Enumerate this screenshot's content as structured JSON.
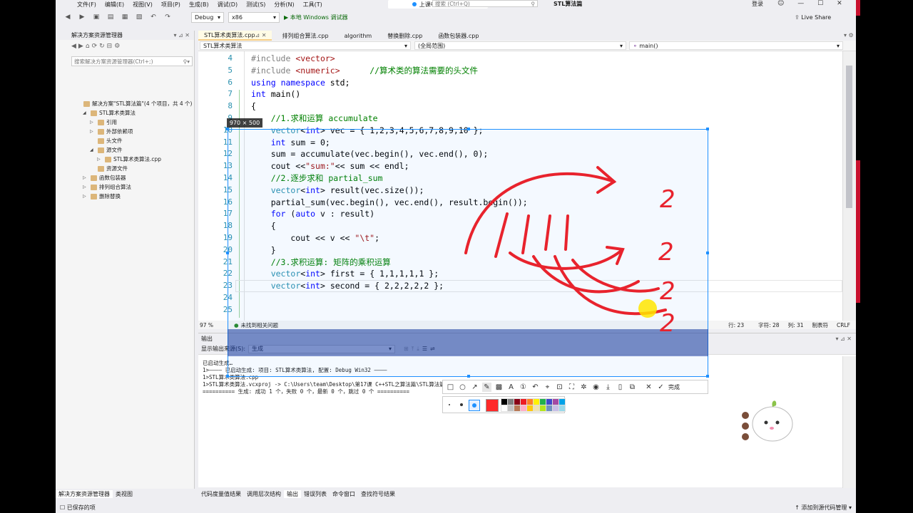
{
  "menu": [
    "文件(F)",
    "编辑(E)",
    "视图(V)",
    "项目(P)",
    "生成(B)",
    "调试(D)",
    "测试(S)",
    "分析(N)",
    "工具(T)"
  ],
  "live": {
    "recording": "上课中 02:10:56",
    "search_placeholder": "搜索 (Ctrl+Q)",
    "app_title": "STL算法篇",
    "login": "登录",
    "liveshare": "Live Share"
  },
  "toolbar": {
    "config": "Debug",
    "platform": "x86",
    "run": "▶ 本地 Windows 调试器"
  },
  "solution": {
    "title": "解决方案资源管理器",
    "search_placeholder": "搜索解决方案资源管理器(Ctrl+;)",
    "items": [
      {
        "label": "解决方案\"STL算法篇\"(4 个项目，共 4 个)",
        "indent": 0,
        "tri": ""
      },
      {
        "label": "STL算术类算法",
        "indent": 1,
        "tri": "◢"
      },
      {
        "label": "引用",
        "indent": 2,
        "tri": "▷"
      },
      {
        "label": "外部依赖项",
        "indent": 2,
        "tri": "▷"
      },
      {
        "label": "头文件",
        "indent": 2,
        "tri": ""
      },
      {
        "label": "源文件",
        "indent": 2,
        "tri": "◢"
      },
      {
        "label": "STL算术类算法.cpp",
        "indent": 3,
        "tri": "▷"
      },
      {
        "label": "资源文件",
        "indent": 2,
        "tri": ""
      },
      {
        "label": "函数包装器",
        "indent": 1,
        "tri": "▷"
      },
      {
        "label": "排列组合算法",
        "indent": 1,
        "tri": "▷"
      },
      {
        "label": "删除替换",
        "indent": 1,
        "tri": "▷"
      }
    ],
    "bottom_tabs": [
      "解决方案资源管理器",
      "类视图"
    ]
  },
  "editor": {
    "tabs": [
      "STL算术类算法.cpp",
      "排列组合算法.cpp",
      "algorithm",
      "替换删除.cpp",
      "函数包装器.cpp"
    ],
    "nav": {
      "project": "STL算术类算法",
      "scope": "(全局范围)",
      "member": "main()"
    },
    "zoom": "97 %",
    "issues": "未找到相关问题",
    "line_no": "行: 23",
    "char_no": "字符: 28",
    "col_no": "列: 31",
    "tabs_mode": "制表符",
    "eol": "CRLF",
    "lines": [
      {
        "n": "4",
        "html": "<span class='pp'>#include</span> <span class='inc'>&lt;vector&gt;</span>"
      },
      {
        "n": "5",
        "html": "<span class='pp'>#include</span> <span class='inc'>&lt;numeric&gt;</span>      <span class='cm'>//算术类的算法需要的头文件</span>"
      },
      {
        "n": "6",
        "html": "<span class='kw'>using</span> <span class='kw'>namespace</span> std;"
      },
      {
        "n": "7",
        "html": "<span class='kw'>int</span> main()"
      },
      {
        "n": "8",
        "html": "{"
      },
      {
        "n": "9",
        "html": "    <span class='cm'>//1.求和运算 accumulate</span>"
      },
      {
        "n": "10",
        "html": "    <span class='ty'>vector</span>&lt;<span class='kw'>int</span>&gt; vec = { 1,2,3,4,5,6,7,8,9,10 };"
      },
      {
        "n": "11",
        "html": "    <span class='kw'>int</span> sum = 0;"
      },
      {
        "n": "12",
        "html": "    sum = accumulate(vec.begin(), vec.end(), 0);"
      },
      {
        "n": "13",
        "html": "    cout &lt;&lt;<span class='st'>\"sum:\"</span>&lt;&lt; sum &lt;&lt; endl;"
      },
      {
        "n": "14",
        "html": "    <span class='cm'>//2.逐步求和 partial_sum</span>"
      },
      {
        "n": "15",
        "html": "    <span class='ty'>vector</span>&lt;<span class='kw'>int</span>&gt; result(vec.size());"
      },
      {
        "n": "16",
        "html": "    partial_sum(vec.begin(), vec.end(), result.begin());"
      },
      {
        "n": "17",
        "html": "    <span class='kw'>for</span> (<span class='kw'>auto</span> v : result)"
      },
      {
        "n": "18",
        "html": "    {"
      },
      {
        "n": "19",
        "html": "        cout &lt;&lt; v &lt;&lt; <span class='st'>\"\\t\"</span>;"
      },
      {
        "n": "20",
        "html": "    }"
      },
      {
        "n": "21",
        "html": "    <span class='cm'>//3.求积运算: 矩阵的乘积运算</span>"
      },
      {
        "n": "22",
        "html": "    <span class='ty'>vector</span>&lt;<span class='kw'>int</span>&gt; first = { 1,1,1,1,1 };"
      },
      {
        "n": "23",
        "html": "    <span class='ty'>vector</span>&lt;<span class='kw'>int</span>&gt; second = { 2,2,2,2,2 };"
      },
      {
        "n": "24",
        "html": ""
      },
      {
        "n": "25",
        "html": ""
      }
    ]
  },
  "output": {
    "title": "输出",
    "source_label": "显示输出来源(S):",
    "source_value": "生成",
    "lines": [
      "已启动生成…",
      "1>———— 已启动生成: 项目: STL算术类算法, 配置: Debug Win32 ————",
      "1>STL算术类算法.cpp",
      "1>STL算术类算法.vcxproj -> C:\\Users\\team\\Desktop\\第17课 C++STL之算法篇\\STL算法篇",
      "========== 生成: 成功 1 个，失败 0 个，最新 0 个，跳过 0 个 =========="
    ]
  },
  "bottom_tabs": [
    "代码度量值结果",
    "调用层次结构",
    "输出",
    "错误列表",
    "命令窗口",
    "查找符号结果"
  ],
  "status": {
    "left": "已保存的项",
    "right": "↑ 添加到源代码管理 ▾"
  },
  "capture": {
    "size": "970 × 500",
    "done": "完成"
  },
  "annotation": {
    "digits": [
      "2",
      "2",
      "2",
      "2"
    ]
  }
}
